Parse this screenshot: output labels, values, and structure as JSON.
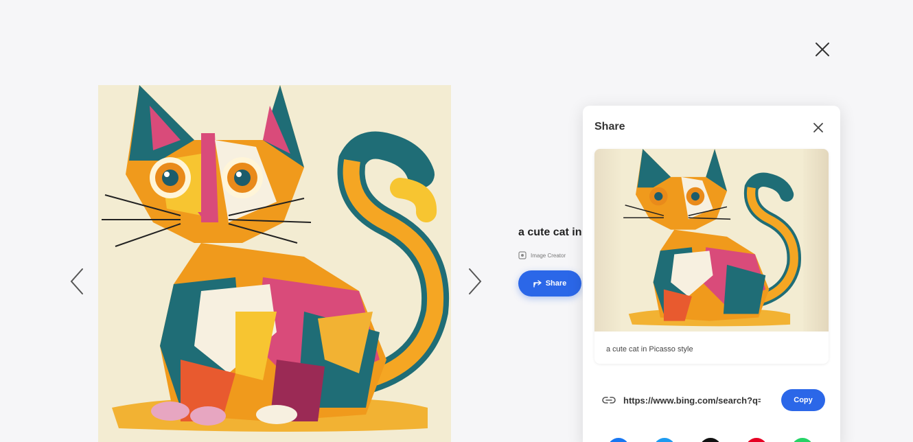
{
  "viewer": {
    "close_icon": "close-icon",
    "prev_icon": "chevron-left-icon",
    "next_icon": "chevron-right-icon"
  },
  "details": {
    "title": "a cute cat in Picasso style",
    "creator": "Image Creator",
    "share_label": "Share"
  },
  "share_panel": {
    "title": "Share",
    "caption": "a cute cat in Picasso style",
    "link": "https://www.bing.com/search?q=a+cute+cat+in+Picasso+style",
    "copy_label": "Copy",
    "social": [
      {
        "name": "facebook",
        "color": "#1877f2"
      },
      {
        "name": "twitter",
        "color": "#1d9bf0"
      },
      {
        "name": "x",
        "color": "#111111"
      },
      {
        "name": "pinterest",
        "color": "#e60023"
      },
      {
        "name": "whatsapp",
        "color": "#25d366"
      }
    ]
  },
  "colors": {
    "accent": "#2b67e8",
    "background": "#f6f6f8",
    "canvas": "#f3ecd2"
  }
}
